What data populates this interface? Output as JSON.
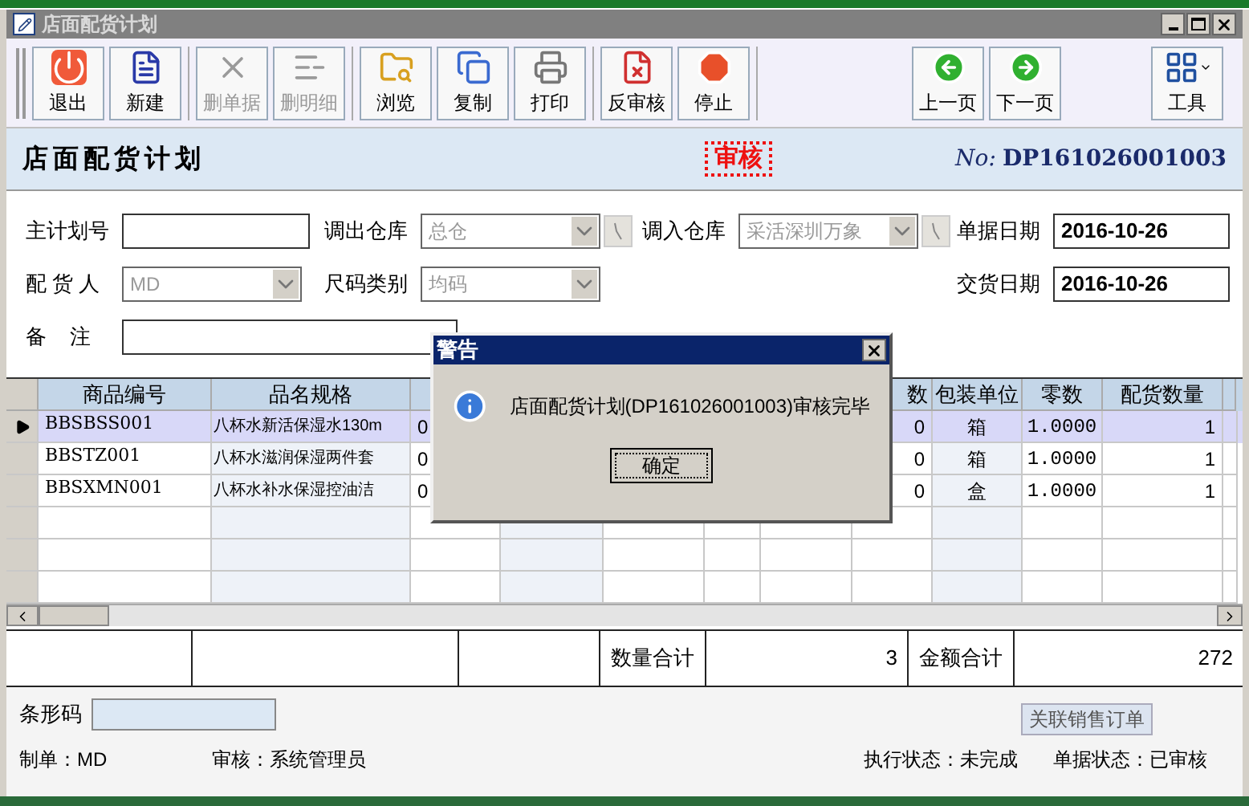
{
  "window": {
    "title": "店面配货计划"
  },
  "toolbar": {
    "groups": [
      [
        {
          "label": "退出",
          "disabled": false
        },
        {
          "label": "新建",
          "disabled": false
        }
      ],
      [
        {
          "label": "删单据",
          "disabled": true
        },
        {
          "label": "删明细",
          "disabled": true
        }
      ],
      [
        {
          "label": "浏览",
          "disabled": false
        },
        {
          "label": "复制",
          "disabled": false
        },
        {
          "label": "打印",
          "disabled": false
        }
      ],
      [
        {
          "label": "反审核",
          "disabled": false
        },
        {
          "label": "停止",
          "disabled": false
        }
      ],
      [
        {
          "label": "上一页",
          "disabled": false
        },
        {
          "label": "下一页",
          "disabled": false
        }
      ],
      [
        {
          "label": "工具",
          "disabled": false
        }
      ]
    ]
  },
  "header": {
    "title": "店面配货计划",
    "stamp": "审核",
    "number_label": "No:",
    "number": "DP161026001003"
  },
  "form": {
    "rows": [
      [
        {
          "label": "主计划号",
          "kind": "text"
        },
        {
          "label": "调出仓库",
          "kind": "combo",
          "value": "总仓",
          "disabled": true,
          "lookup": true
        },
        {
          "label": "调入仓库",
          "kind": "combo",
          "value": "采活深圳万象",
          "disabled": true,
          "lookup": true
        },
        {
          "label": "单据日期",
          "kind": "date",
          "value": "2016-10-26"
        }
      ],
      [
        {
          "label": "配 货 人",
          "kind": "combo",
          "value": "MD",
          "disabled": true,
          "lookup": false
        },
        {
          "label": "尺码类别",
          "kind": "combo",
          "value": "均码",
          "disabled": true,
          "lookup": false
        },
        "",
        {
          "label": "交货日期",
          "kind": "date",
          "value": "2016-10-26"
        }
      ],
      [
        {
          "label": "备    注",
          "kind": "wide"
        }
      ]
    ]
  },
  "table": {
    "columns": [
      "商品编号",
      "品名规格",
      "数",
      "包装单位",
      "零数",
      "配货数量"
    ],
    "rows": [
      {
        "selected": true,
        "code": "BBSBSS001",
        "name": "八杯水新活保湿水130m",
        "column_3": "0",
        "count": "0",
        "unit": "箱",
        "loose": "1.0000",
        "quantity": "1"
      },
      {
        "selected": false,
        "code": "BBSTZ001",
        "name": "八杯水滋润保湿两件套",
        "column_3": "0",
        "count": "0",
        "unit": "箱",
        "loose": "1.0000",
        "quantity": "1"
      },
      {
        "selected": false,
        "code": "BBSXMN001",
        "name": "八杯水补水保湿控油洁",
        "column_3": "0",
        "count": "0",
        "unit": "盒",
        "loose": "1.0000",
        "quantity": "1"
      }
    ]
  },
  "totals": {
    "quantity_label": "数量合计",
    "quantity": "3",
    "amount_label": "金额合计",
    "amount": "272"
  },
  "barcode": {
    "label": "条形码"
  },
  "link_button": "关联销售订单",
  "status": {
    "maker": "制单：MD",
    "auditor": "审核：系统管理员",
    "execution": "执行状态：未完成",
    "document": "单据状态：已审核"
  },
  "dialog": {
    "title": "警告",
    "message": "店面配货计划(DP161026001003)审核完毕",
    "button": "确定"
  }
}
